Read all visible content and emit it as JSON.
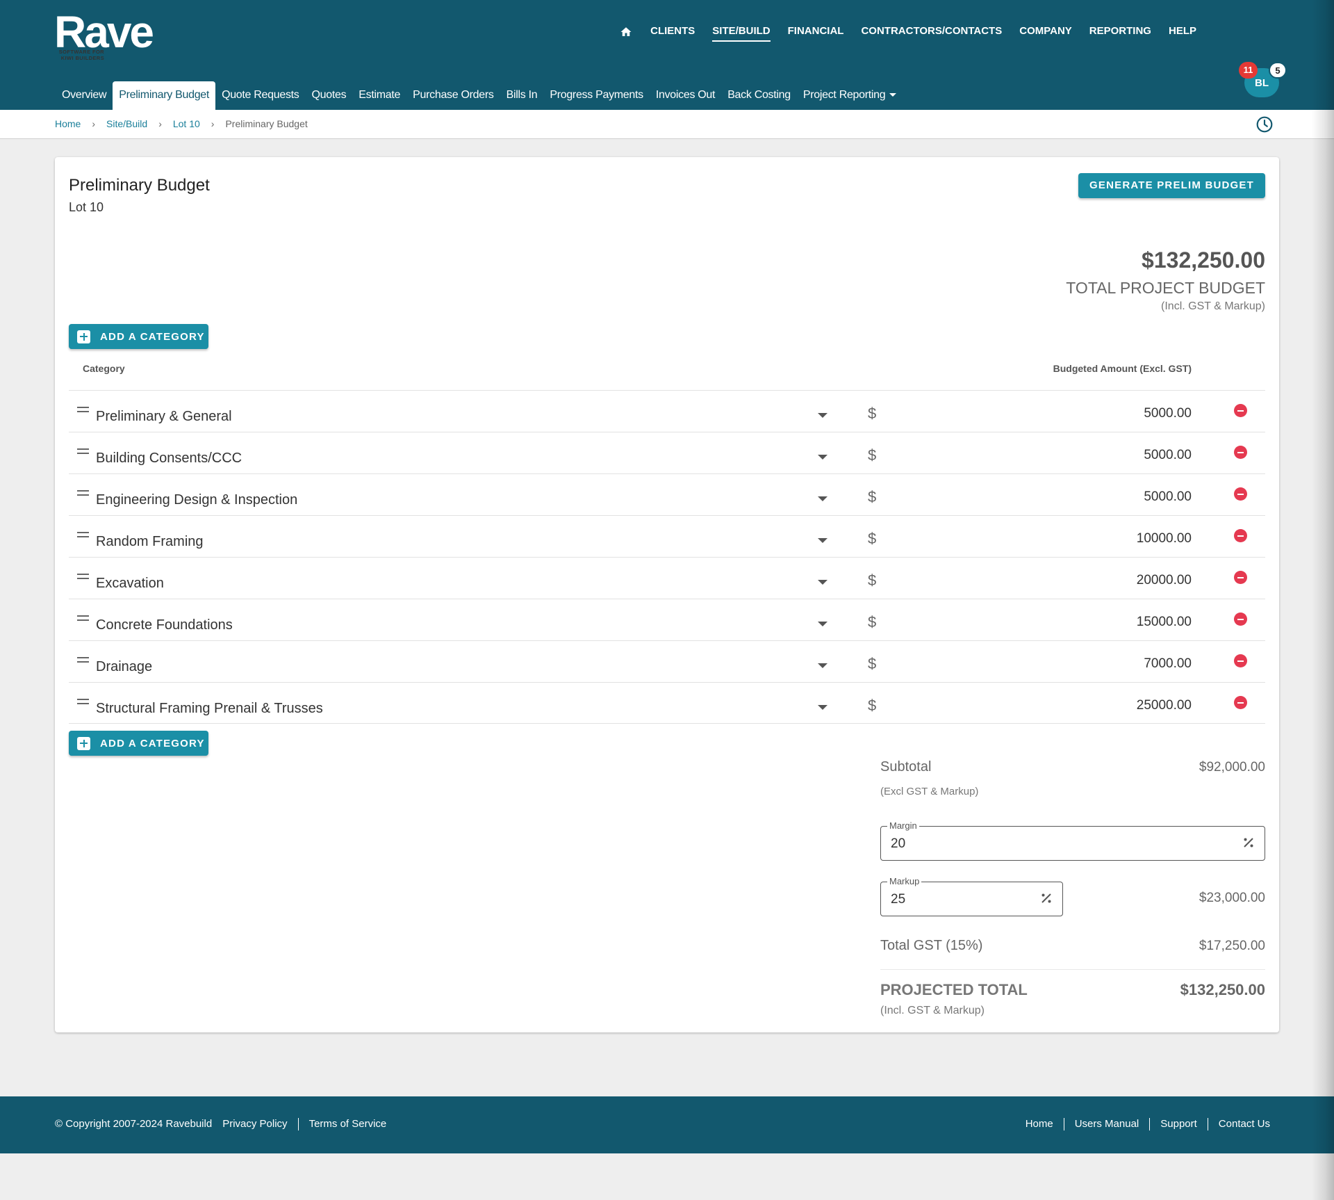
{
  "brand": {
    "name": "Rave",
    "tagline_1": "SOFTWARE FOR",
    "tagline_2": "KIWI BUILDERS"
  },
  "topnav": {
    "icon": "home-icon",
    "items": [
      "CLIENTS",
      "SITE/BUILD",
      "FINANCIAL",
      "CONTRACTORS/CONTACTS",
      "COMPANY",
      "REPORTING",
      "HELP"
    ],
    "active": "SITE/BUILD"
  },
  "subnav": {
    "tabs": [
      "Overview",
      "Preliminary Budget",
      "Quote Requests",
      "Quotes",
      "Estimate",
      "Purchase Orders",
      "Bills In",
      "Progress Payments",
      "Invoices Out",
      "Back Costing",
      "Project Reporting"
    ],
    "active": "Preliminary Budget"
  },
  "user": {
    "initials": "BL",
    "notifications": "11",
    "messages": "5"
  },
  "breadcrumb": {
    "items": [
      "Home",
      "Site/Build",
      "Lot 10"
    ],
    "current": "Preliminary Budget",
    "separator": "›"
  },
  "page": {
    "title": "Preliminary Budget",
    "subtitle": "Lot 10",
    "generate_label": "GENERATE PRELIM BUDGET",
    "total_amount": "$132,250.00",
    "total_label": "TOTAL PROJECT BUDGET",
    "total_note": "(Incl. GST & Markup)",
    "add_category_label": "ADD A CATEGORY"
  },
  "table": {
    "col_category": "Category",
    "col_amount": "Budgeted Amount (Excl. GST)",
    "currency_symbol": "$",
    "rows": [
      {
        "name": "Preliminary & General",
        "amount": "5000.00"
      },
      {
        "name": "Building Consents/CCC",
        "amount": "5000.00"
      },
      {
        "name": "Engineering Design & Inspection",
        "amount": "5000.00"
      },
      {
        "name": "Random Framing",
        "amount": "10000.00"
      },
      {
        "name": "Excavation",
        "amount": "20000.00"
      },
      {
        "name": "Concrete Foundations",
        "amount": "15000.00"
      },
      {
        "name": "Drainage",
        "amount": "7000.00"
      },
      {
        "name": "Structural Framing Prenail & Trusses",
        "amount": "25000.00"
      }
    ]
  },
  "summary": {
    "subtotal_label": "Subtotal",
    "subtotal_value": "$92,000.00",
    "subtotal_note": "(Excl GST & Markup)",
    "margin_label": "Margin",
    "margin_value": "20",
    "markup_label": "Markup",
    "markup_value": "25",
    "markup_amount": "$23,000.00",
    "gst_label": "Total GST (15%)",
    "gst_value": "$17,250.00",
    "projected_label": "PROJECTED TOTAL",
    "projected_value": "$132,250.00",
    "projected_note": "(Incl. GST & Markup)"
  },
  "footer": {
    "copyright": "© Copyright 2007-2024 Ravebuild",
    "left_links": [
      "Privacy Policy",
      "Terms of Service"
    ],
    "right_links": [
      "Home",
      "Users Manual",
      "Support",
      "Contact Us"
    ]
  },
  "colors": {
    "header": "#12586e",
    "accent": "#1b8fa6",
    "danger": "#e53950"
  }
}
